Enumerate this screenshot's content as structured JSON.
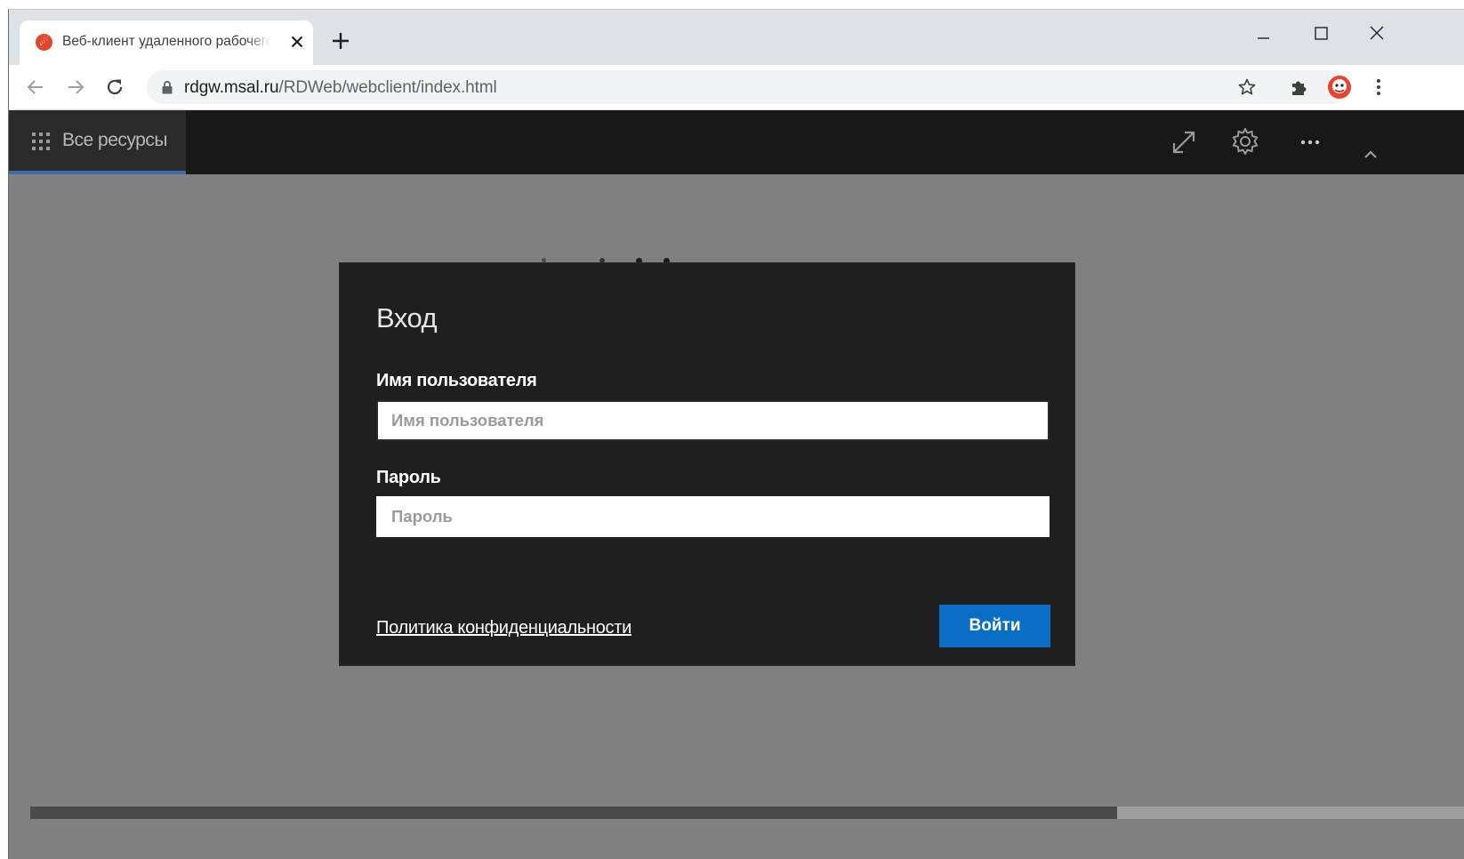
{
  "browser": {
    "tab_title": "Веб-клиент удаленного рабочего стола",
    "url_host": "rdgw.msal.ru",
    "url_path": "/RDWeb/webclient/index.html"
  },
  "app": {
    "nav_label": "Все ресурсы"
  },
  "login": {
    "title": "Вход",
    "username_label": "Имя пользователя",
    "username_placeholder": "Имя пользователя",
    "password_label": "Пароль",
    "password_placeholder": "Пароль",
    "privacy_link": "Политика конфиденциальности",
    "submit_label": "Войти"
  },
  "colors": {
    "accent": "#0a6ec6",
    "dialog_bg": "#1f1f1f",
    "appbar_bg": "#181818",
    "overlay_bg": "#808080"
  }
}
